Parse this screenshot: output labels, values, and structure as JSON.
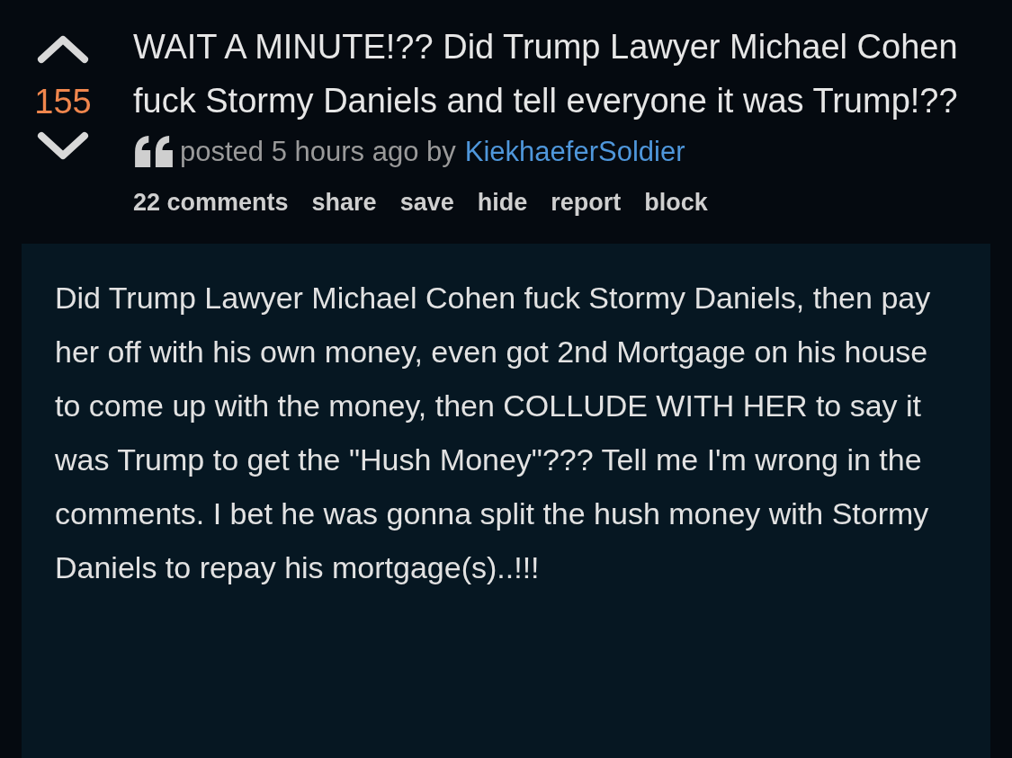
{
  "post": {
    "score": "155",
    "title": "WAIT A MINUTE!?? Did Trump Lawyer Michael Cohen fuck Stormy Daniels and tell everyone it was Trump!??",
    "posted": "posted 5 hours ago by",
    "author": "KiekhaeferSoldier",
    "actions": [
      {
        "label": "22 comments"
      },
      {
        "label": "share"
      },
      {
        "label": "save"
      },
      {
        "label": "hide"
      },
      {
        "label": "report"
      },
      {
        "label": "block"
      }
    ],
    "body": "Did Trump Lawyer Michael Cohen fuck Stormy Daniels, then pay her off with his own money, even got 2nd Mortgage on his house to come up with the money, then COLLUDE WITH HER to say it was Trump to get the \"Hush Money\"??? Tell me I'm wrong in the comments. I bet he was gonna split the hush money with Stormy Daniels to repay his mortgage(s)..!!!"
  }
}
